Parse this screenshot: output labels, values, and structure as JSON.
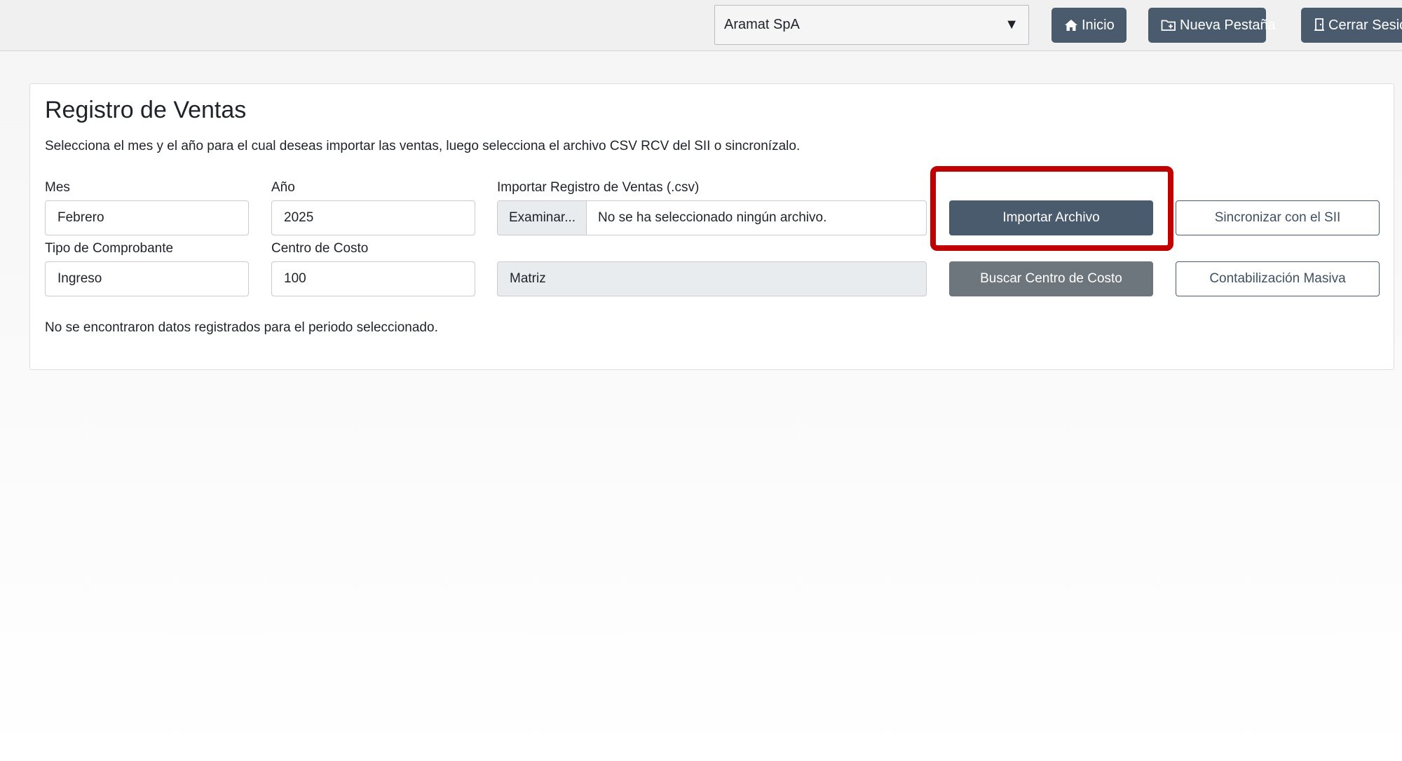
{
  "topbar": {
    "company": "Aramat SpA",
    "company_caret": "▼",
    "nav": {
      "home_label": "Inicio",
      "new_tab_label": "Nueva Pestaña",
      "logout_label": "Cerrar Sesió"
    }
  },
  "page": {
    "title": "Registro de Ventas",
    "subtitle": "Selecciona el mes y el año para el cual deseas importar las ventas, luego selecciona el archivo CSV RCV del SII o sincronízalo.",
    "empty_message": "No se encontraron datos registrados para el periodo seleccionado."
  },
  "form": {
    "month": {
      "label": "Mes",
      "value": "Febrero"
    },
    "year": {
      "label": "Año",
      "value": "2025"
    },
    "file": {
      "label": "Importar Registro de Ventas (.csv)",
      "browse": "Examinar...",
      "status": "No se ha seleccionado ningún archivo."
    },
    "voucher_type": {
      "label": "Tipo de Comprobante",
      "value": "Ingreso"
    },
    "cost_center": {
      "label": "Centro de Costo",
      "value": "100",
      "name": "Matriz"
    }
  },
  "buttons": {
    "import": "Importar Archivo",
    "sync": "Sincronizar con el SII",
    "search_cost_center": "Buscar Centro de Costo",
    "bulk_accounting": "Contabilización Masiva"
  },
  "colors": {
    "primary": "#4a5b6e",
    "secondary": "#6e767d",
    "highlight": "#c00000"
  }
}
